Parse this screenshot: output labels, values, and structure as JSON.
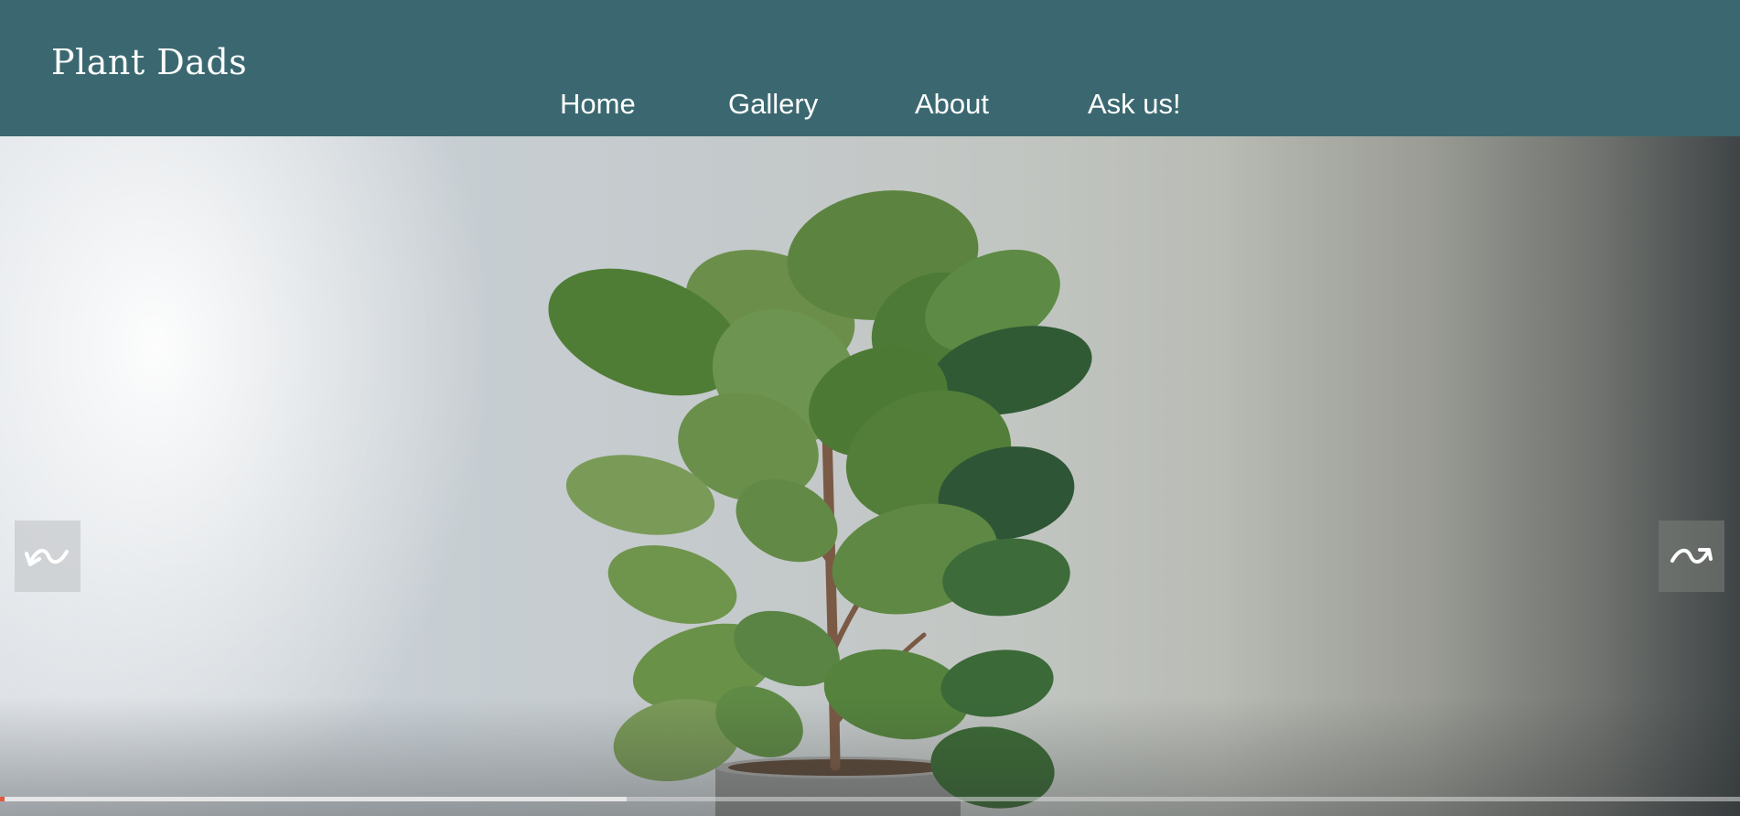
{
  "site": {
    "logo": "Plant Dads"
  },
  "nav": {
    "items": [
      {
        "label": "Home"
      },
      {
        "label": "Gallery"
      },
      {
        "label": "About"
      },
      {
        "label": "Ask us!"
      }
    ]
  },
  "carousel": {
    "prev_icon": "curved-back-arrow-icon",
    "next_icon": "curved-forward-arrow-icon",
    "progress": 0.36,
    "colors": {
      "header": "#3b6870",
      "progress_start": "#e0583f"
    }
  }
}
